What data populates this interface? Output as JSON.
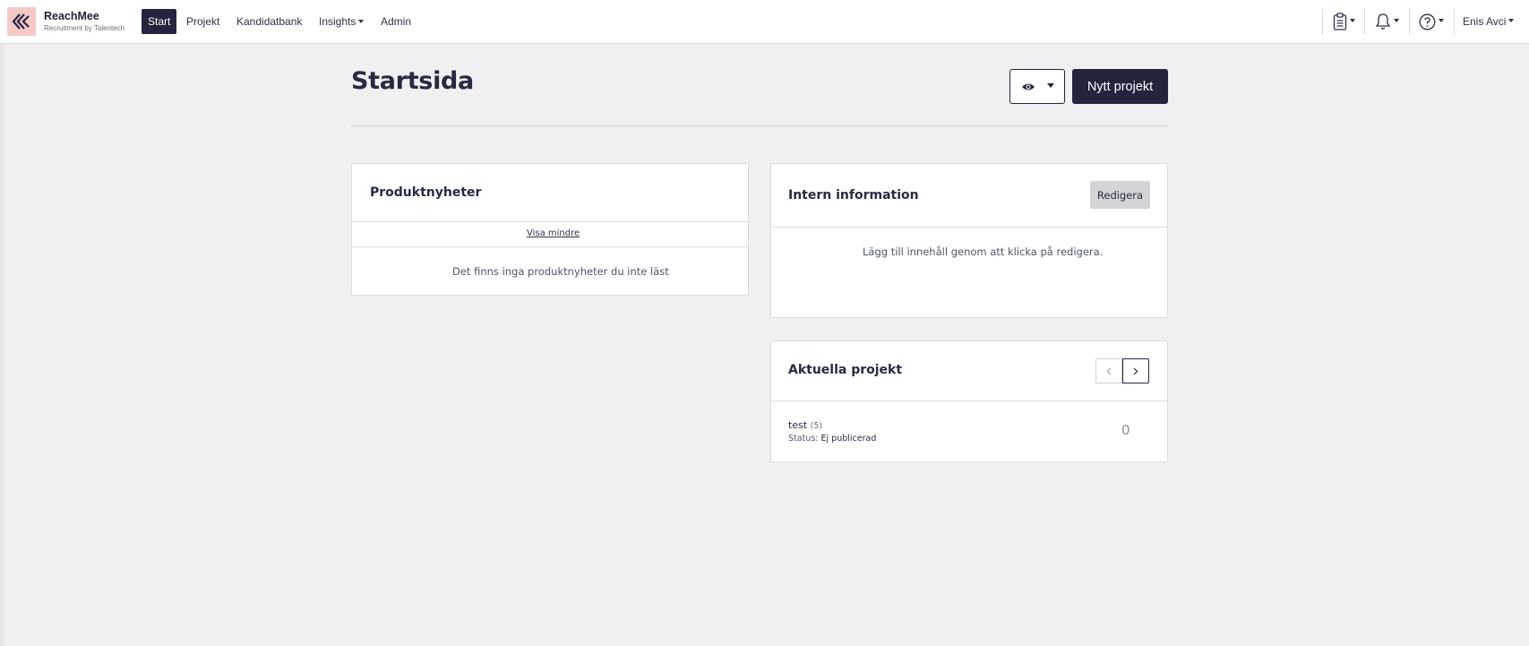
{
  "navbar": {
    "brand_name": "ReachMee",
    "brand_sub": "Recruitment by Talentech",
    "items": [
      {
        "label": "Start",
        "active": true
      },
      {
        "label": "Projekt"
      },
      {
        "label": "Kandidatbank"
      },
      {
        "label": "Insights",
        "dropdown": true
      },
      {
        "label": "Admin"
      }
    ],
    "icons": [
      "clipboard-icon",
      "bell-icon",
      "help-icon"
    ],
    "user": "Enis Avci"
  },
  "page": {
    "title": "Startsida",
    "view_button_icon": "eye-icon",
    "new_project_label": "Nytt projekt"
  },
  "product_news": {
    "title": "Produktnyheter",
    "toggle_label": "Visa mindre",
    "empty_text": "Det finns inga produktnyheter du inte läst"
  },
  "internal_info": {
    "title": "Intern information",
    "edit_label": "Redigera",
    "empty_text": "Lägg till innehåll genom att klicka på redigera."
  },
  "current_projects": {
    "title": "Aktuella projekt",
    "projects": [
      {
        "name": "test",
        "count": "(5)",
        "status_label": "Status:",
        "status_value": "Ej publicerad",
        "number": "0"
      }
    ]
  },
  "colors": {
    "primary": "#23253e",
    "background": "#f0f0f2",
    "logo_bg": "#f6c9c9"
  }
}
